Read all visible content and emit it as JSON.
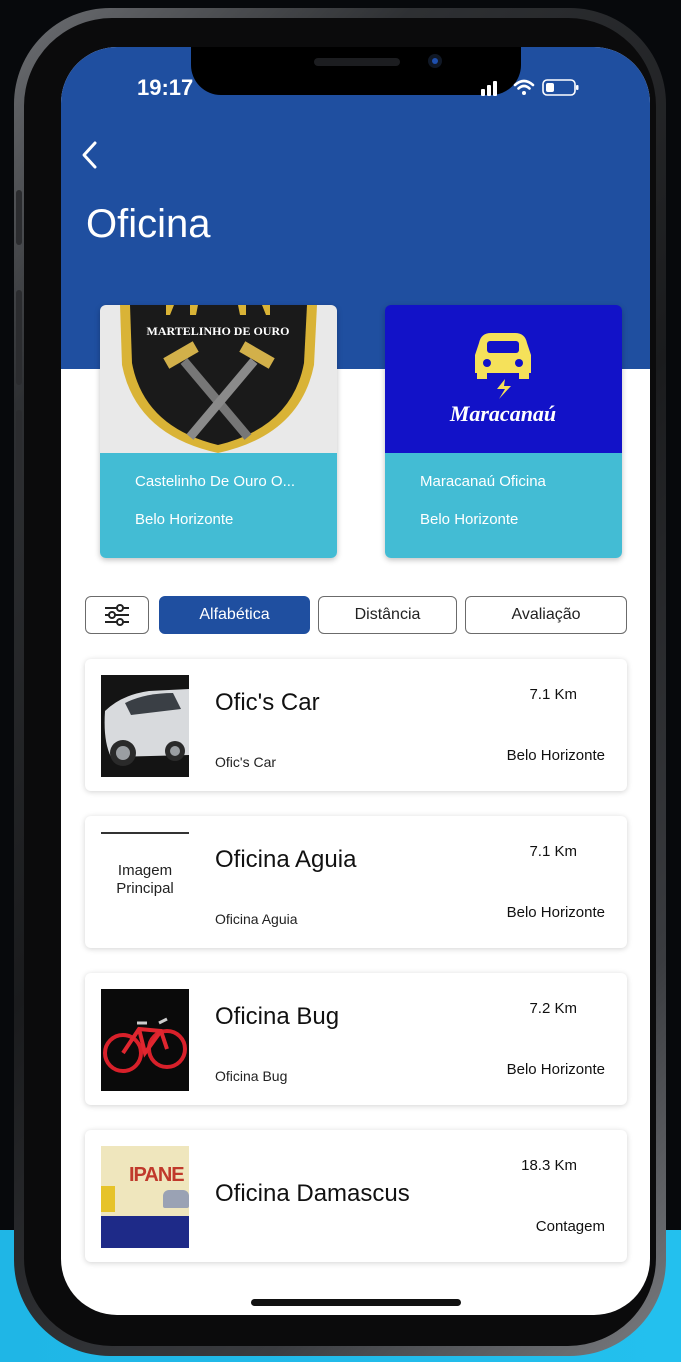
{
  "status": {
    "time": "19:17"
  },
  "header": {
    "title": "Oficina"
  },
  "featured": [
    {
      "name": "Castelinho De Ouro O...",
      "city": "Belo Horizonte",
      "logo_text": "MARTELINHO DE OURO"
    },
    {
      "name": "Maracanaú Oficina",
      "city": "Belo Horizonte",
      "logo_text": "Maracanaú"
    }
  ],
  "filters": {
    "icon": "sliders-icon",
    "options": [
      "Alfabética",
      "Distância",
      "Avaliação"
    ],
    "selected": "Alfabética"
  },
  "workshops": [
    {
      "title": "Ofic's Car",
      "subtitle": "Ofic's Car",
      "distance": "7.1 Km",
      "city": "Belo Horizonte",
      "thumb": "car-photo"
    },
    {
      "title": "Oficina Aguia",
      "subtitle": "Oficina Aguia",
      "distance": "7.1 Km",
      "city": "Belo Horizonte",
      "thumb": "placeholder",
      "thumb_text": "Imagem Principal"
    },
    {
      "title": "Oficina Bug",
      "subtitle": "Oficina Bug",
      "distance": "7.2 Km",
      "city": "Belo Horizonte",
      "thumb": "bike-photo"
    },
    {
      "title": "Oficina Damascus",
      "subtitle": "",
      "distance": "18.3 Km",
      "city": "Contagem",
      "thumb": "ipanema-sign",
      "thumb_text": "IPANE"
    }
  ],
  "colors": {
    "primary": "#1f4fa0",
    "card_info": "#43bcd4"
  }
}
